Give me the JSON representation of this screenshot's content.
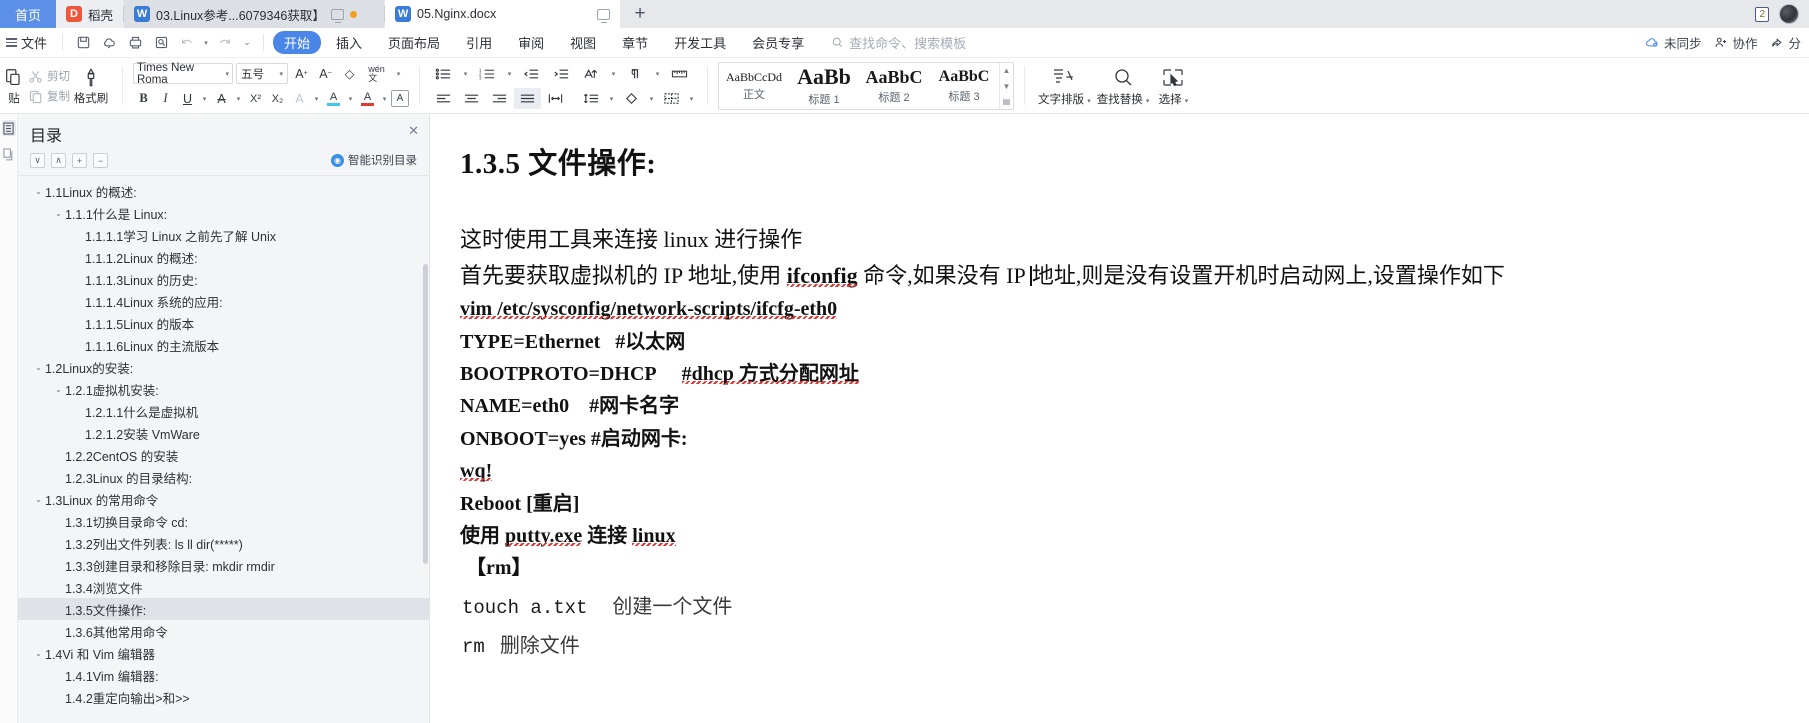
{
  "tabbar": {
    "home_label": "首页",
    "tabs": [
      {
        "icon": "wps-red-icon",
        "label": "稻壳",
        "type": "docer"
      },
      {
        "icon": "wps-blue-icon",
        "label": "03.Linux参考...6079346获取】",
        "type": "doc",
        "active": false,
        "has_monitor": true,
        "has_dot": true
      },
      {
        "icon": "wps-blue-icon",
        "label": "05.Nginx.docx",
        "type": "doc",
        "active": true,
        "has_monitor": true
      }
    ],
    "new_tab_label": "+",
    "window_count": "2",
    "avatar_label": "用户头像"
  },
  "menubar": {
    "file_label": "文件",
    "quick_icons": [
      "save-icon",
      "cloud-save-icon",
      "print-icon",
      "print-preview-icon",
      "undo-icon",
      "redo-icon",
      "customize-icon"
    ],
    "tabs": [
      {
        "label": "开始",
        "active": true
      },
      {
        "label": "插入",
        "active": false
      },
      {
        "label": "页面布局",
        "active": false
      },
      {
        "label": "引用",
        "active": false
      },
      {
        "label": "审阅",
        "active": false
      },
      {
        "label": "视图",
        "active": false
      },
      {
        "label": "章节",
        "active": false
      },
      {
        "label": "开发工具",
        "active": false
      },
      {
        "label": "会员专享",
        "active": false
      }
    ],
    "search_placeholder": "查找命令、搜索模板",
    "right_items": [
      {
        "icon": "cloud-sync-icon",
        "label": "未同步"
      },
      {
        "icon": "collaborate-icon",
        "label": "协作"
      },
      {
        "icon": "share-icon",
        "label": "分"
      }
    ]
  },
  "ribbon": {
    "clipboard": {
      "paste_label": "贴",
      "cut_label": "剪切",
      "copy_label": "复制",
      "format_painter_label": "格式刷"
    },
    "font": {
      "name_value": "Times New Roma",
      "size_value": "五号",
      "grow_icon": "increase-font-size-icon",
      "shrink_icon": "decrease-font-size-icon",
      "clear_format_icon": "clear-formatting-icon",
      "pinyin_icon": "pinyin-guide-icon",
      "bold_label": "B",
      "italic_label": "I",
      "underline_label": "U",
      "strikethrough_label": "A",
      "superscript_label": "X²",
      "subscript_label": "X₂",
      "char_case_label": "A",
      "text_highlight_label": "A",
      "font_color_label": "A",
      "char_border_label": "A"
    },
    "paragraph": {
      "bullets_icon": "bulleted-list-icon",
      "numbering_icon": "numbered-list-icon",
      "decrease_indent_icon": "decrease-indent-icon",
      "increase_indent_icon": "increase-indent-icon",
      "sort_icon": "sort-icon",
      "show_marks_icon": "show-paragraph-marks-icon",
      "align_left_icon": "align-left-icon",
      "align_center_icon": "align-center-icon",
      "align_right_icon": "align-right-icon",
      "justify_icon": "justify-icon",
      "distribute_icon": "distribute-icon",
      "line_spacing_icon": "line-spacing-icon",
      "shading_icon": "shading-icon",
      "borders_icon": "borders-icon"
    },
    "styles": {
      "items": [
        {
          "preview": "AaBbCcDd",
          "name": "正文",
          "size": 12
        },
        {
          "preview": "AaBb",
          "name": "标题 1",
          "size": 22
        },
        {
          "preview": "AaBbC",
          "name": "标题 2",
          "size": 18
        },
        {
          "preview": "AaBbC",
          "name": "标题 3",
          "size": 16
        }
      ]
    },
    "tools": {
      "typeset_label": "文字排版",
      "typeset_icon": "text-typeset-icon",
      "find_replace_label": "查找替换",
      "find_replace_icon": "search-icon",
      "select_label": "选择",
      "select_icon": "select-objects-icon"
    }
  },
  "leftrail": {
    "items": [
      "outline-pane-icon",
      "thumbnail-pane-icon"
    ]
  },
  "navpane": {
    "title": "目录",
    "close_icon": "close-icon",
    "tools": [
      {
        "icon": "move-down-icon",
        "label": "∨"
      },
      {
        "icon": "move-up-icon",
        "label": "∧"
      },
      {
        "icon": "expand-all-icon",
        "label": "+"
      },
      {
        "icon": "collapse-all-icon",
        "label": "−"
      }
    ],
    "smart_label": "智能识别目录",
    "smart_icon": "smart-recognize-icon",
    "tree": [
      {
        "label": "1.1Linux 的概述:",
        "indent": 1,
        "chev": "∨",
        "sel": false
      },
      {
        "label": "1.1.1什么是 Linux:",
        "indent": 2,
        "chev": "∨",
        "sel": false
      },
      {
        "label": "1.1.1.1学习 Linux 之前先了解 Unix",
        "indent": 3,
        "chev": "",
        "sel": false
      },
      {
        "label": "1.1.1.2Linux 的概述:",
        "indent": 3,
        "chev": "",
        "sel": false
      },
      {
        "label": "1.1.1.3Linux 的历史:",
        "indent": 3,
        "chev": "",
        "sel": false
      },
      {
        "label": "1.1.1.4Linux 系统的应用:",
        "indent": 3,
        "chev": "",
        "sel": false
      },
      {
        "label": "1.1.1.5Linux 的版本",
        "indent": 3,
        "chev": "",
        "sel": false
      },
      {
        "label": "1.1.1.6Linux 的主流版本",
        "indent": 3,
        "chev": "",
        "sel": false
      },
      {
        "label": "1.2Linux的安装:",
        "indent": 1,
        "chev": "∨",
        "sel": false
      },
      {
        "label": "1.2.1虚拟机安装:",
        "indent": 2,
        "chev": "∨",
        "sel": false
      },
      {
        "label": "1.2.1.1什么是虚拟机",
        "indent": 3,
        "chev": "",
        "sel": false
      },
      {
        "label": "1.2.1.2安装 VmWare",
        "indent": 3,
        "chev": "",
        "sel": false
      },
      {
        "label": "1.2.2CentOS 的安装",
        "indent": 2,
        "chev": "",
        "sel": false
      },
      {
        "label": "1.2.3Linux 的目录结构:",
        "indent": 2,
        "chev": "",
        "sel": false
      },
      {
        "label": "1.3Linux 的常用命令",
        "indent": 1,
        "chev": "∨",
        "sel": false
      },
      {
        "label": "1.3.1切换目录命令 cd:",
        "indent": 2,
        "chev": "",
        "sel": false
      },
      {
        "label": "1.3.2列出文件列表: ls ll dir(*****)",
        "indent": 2,
        "chev": "",
        "sel": false
      },
      {
        "label": "1.3.3创建目录和移除目录: mkdir rmdir",
        "indent": 2,
        "chev": "",
        "sel": false
      },
      {
        "label": "1.3.4浏览文件",
        "indent": 2,
        "chev": "",
        "sel": false
      },
      {
        "label": "1.3.5文件操作:",
        "indent": 2,
        "chev": "",
        "sel": true
      },
      {
        "label": "1.3.6其他常用命令",
        "indent": 2,
        "chev": "",
        "sel": false
      },
      {
        "label": "1.4Vi 和 Vim 编辑器",
        "indent": 1,
        "chev": "∨",
        "sel": false
      },
      {
        "label": "1.4.1Vim 编辑器:",
        "indent": 2,
        "chev": "",
        "sel": false
      },
      {
        "label": "1.4.2重定向输出>和>>",
        "indent": 2,
        "chev": "",
        "sel": false
      }
    ]
  },
  "document": {
    "heading": "1.3.5  文件操作:",
    "lines": [
      {
        "id": "l1",
        "text": "这时使用工具来连接 linux 进行操作",
        "style": "big"
      },
      {
        "id": "l2a",
        "text": "首先要获取虚拟机的 IP 地址,使用 ",
        "style": "big-prefix"
      },
      {
        "id": "l2b",
        "text": "ifconfig",
        "style": "bold-squiggle"
      },
      {
        "id": "l2c",
        "text": " 命令,如果没有 IP ",
        "style": "big"
      },
      {
        "id": "l2d",
        "text": "地址,则是没有设置开机时启动网上,设置操作如下",
        "style": "big"
      },
      {
        "id": "l3",
        "text": "vim /etc/sysconfig/network-scripts/ifcfg-eth0",
        "style": "bold"
      },
      {
        "id": "l4a",
        "text": "TYPE=Ethernet",
        "style": "bold"
      },
      {
        "id": "l4b",
        "text": "#以太网",
        "style": "bold"
      },
      {
        "id": "l5a",
        "text": "BOOTPROTO=DHCP",
        "style": "bold"
      },
      {
        "id": "l5b",
        "text": "#dhcp 方式分配网址",
        "style": "bold"
      },
      {
        "id": "l6a",
        "text": "NAME=eth0",
        "style": "bold"
      },
      {
        "id": "l6b",
        "text": "#网卡名字",
        "style": "bold"
      },
      {
        "id": "l7",
        "text": "ONBOOT=yes #启动网卡:",
        "style": "bold"
      },
      {
        "id": "l8",
        "text": "wq!",
        "style": "bold"
      },
      {
        "id": "l9",
        "text": "Reboot [重启]",
        "style": "bold"
      },
      {
        "id": "l10a",
        "text": "使用 ",
        "style": "bold"
      },
      {
        "id": "l10b",
        "text": "putty.exe",
        "style": "bold-squiggle"
      },
      {
        "id": "l10c",
        "text": " 连接 ",
        "style": "bold"
      },
      {
        "id": "l10d",
        "text": "linux",
        "style": "bold-squiggle"
      },
      {
        "id": "l11",
        "text": "【rm】",
        "style": "bold"
      },
      {
        "id": "l12a",
        "text": "touch a.txt",
        "style": "mono"
      },
      {
        "id": "l12b",
        "text": "创建一个文件",
        "style": "cn"
      },
      {
        "id": "l13a",
        "text": "rm",
        "style": "mono"
      },
      {
        "id": "l13b",
        "text": "删除文件",
        "style": "cn"
      }
    ]
  }
}
